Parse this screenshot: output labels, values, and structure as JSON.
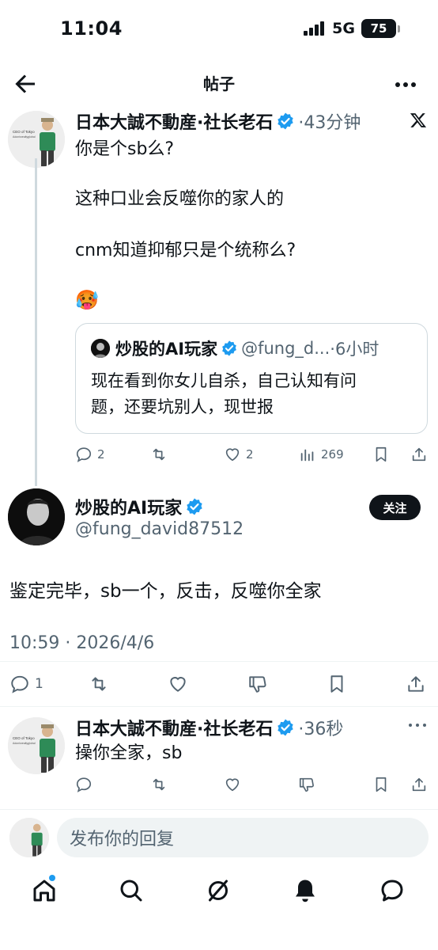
{
  "status_bar": {
    "time": "11:04",
    "network": "5G",
    "battery": "75"
  },
  "header": {
    "title": "帖子"
  },
  "quoted_context_tweet": {
    "author_name": "日本大誠不動産·社长老石",
    "time": "·43分钟",
    "lines": [
      "你是个sb么?",
      "这种口业会反噬你的家人的",
      "cnm知道抑郁只是个统称么?"
    ],
    "emoji": "🥵",
    "quote": {
      "author_name": "炒股的AI玩家",
      "handle": "@fung_d...",
      "time": "·6小时",
      "text_lines": [
        "现在看到你女儿自杀，自己认知有问",
        "题，还要坑别人，现世报"
      ]
    },
    "actions": {
      "replies": "2",
      "likes": "2",
      "views": "269"
    }
  },
  "main_tweet": {
    "author_name": "炒股的AI玩家",
    "handle": "@fung_david87512",
    "follow_label": "关注",
    "text": "鉴定完毕，sb一个，反击，反噬你全家",
    "timestamp": "10:59 · 2026/4/6",
    "actions": {
      "replies": "1"
    }
  },
  "reply_tweet": {
    "author_name": "日本大誠不動産·社长老石",
    "time": "·36秒",
    "text": "操你全家，sb"
  },
  "composer": {
    "placeholder": "发布你的回复"
  },
  "avatar_text": {
    "ceo_line1": "CEO of Tokyo",
    "ceo_line2": "Adonisrealtyglobal"
  },
  "colors": {
    "verified": "#1d9bf0",
    "text": "#0f1419",
    "muted": "#536471",
    "line": "#cfd9de"
  }
}
